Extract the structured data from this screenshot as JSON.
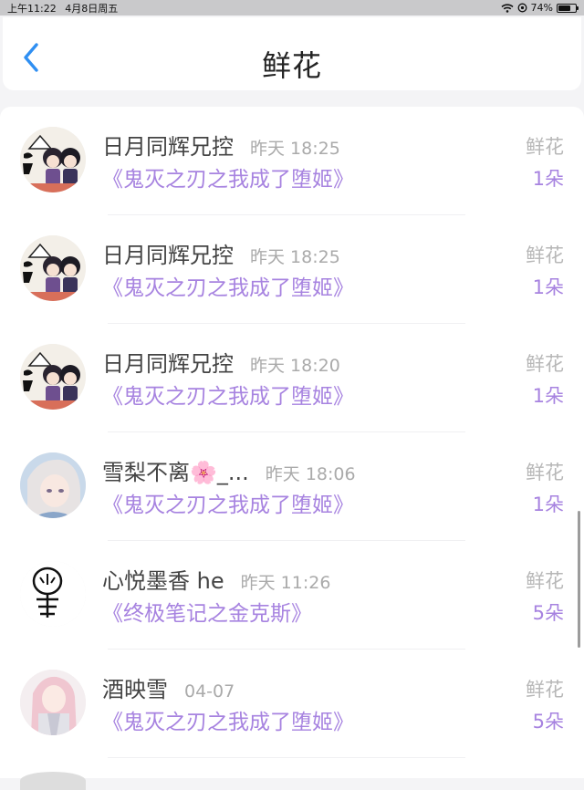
{
  "status_bar": {
    "time": "上午11:22",
    "date": "4月8日周五",
    "battery": "74%",
    "battery_level": 0.74,
    "icons": [
      "wifi-icon",
      "location-lock-icon",
      "battery-icon"
    ]
  },
  "header": {
    "title": "鲜花",
    "back_icon": "chevron-left-icon"
  },
  "colors": {
    "accent_blue": "#2f8ff2",
    "book_purple": "#a783e0",
    "muted_gray": "#aaaaaa"
  },
  "items": [
    {
      "name": "日月同辉兄控",
      "time": "昨天 18:25",
      "book": "《鬼灭之刃之我成了堕姬》",
      "gift_label": "鲜花",
      "gift_count": "1朵",
      "avatar": "chibi-couple-avatar"
    },
    {
      "name": "日月同辉兄控",
      "time": "昨天 18:25",
      "book": "《鬼灭之刃之我成了堕姬》",
      "gift_label": "鲜花",
      "gift_count": "1朵",
      "avatar": "chibi-couple-avatar"
    },
    {
      "name": "日月同辉兄控",
      "time": "昨天 18:20",
      "book": "《鬼灭之刃之我成了堕姬》",
      "gift_label": "鲜花",
      "gift_count": "1朵",
      "avatar": "chibi-couple-avatar"
    },
    {
      "name": "雪梨不离🌸_...",
      "time": "昨天 18:06",
      "book": "《鬼灭之刃之我成了堕姬》",
      "gift_label": "鲜花",
      "gift_count": "1朵",
      "avatar": "anime-girl-avatar"
    },
    {
      "name": "心悦墨香 he",
      "time": "昨天 11:26",
      "book": "《终极笔记之金克斯》",
      "gift_label": "鲜花",
      "gift_count": "5朵",
      "avatar": "stick-figure-avatar"
    },
    {
      "name": "酒映雪",
      "time": "04-07",
      "book": "《鬼灭之刃之我成了堕姬》",
      "gift_label": "鲜花",
      "gift_count": "5朵",
      "avatar": "pink-hair-girl-avatar"
    }
  ]
}
